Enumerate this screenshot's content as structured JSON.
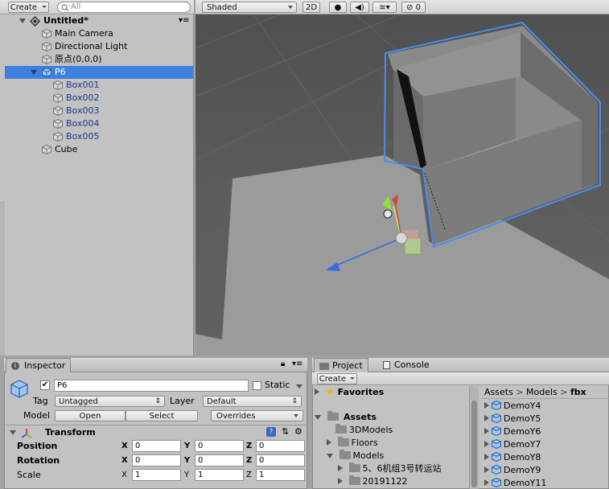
{
  "hierarchy": {
    "create_label": "Create",
    "search_placeholder": "All",
    "scene_name": "Untitled*",
    "items": [
      {
        "label": "Main Camera"
      },
      {
        "label": "Directional Light"
      },
      {
        "label": "原点(0,0,0)"
      },
      {
        "label": "P6",
        "selected": true
      },
      {
        "label": "Box001"
      },
      {
        "label": "Box002"
      },
      {
        "label": "Box003"
      },
      {
        "label": "Box004"
      },
      {
        "label": "Box005"
      },
      {
        "label": "Cube"
      }
    ]
  },
  "scene": {
    "shading_mode": "Shaded",
    "mode_2d": "2D",
    "hidden_count": "0"
  },
  "inspector": {
    "tab_label": "Inspector",
    "object_name": "P6",
    "static_label": "Static",
    "tag_label": "Tag",
    "tag_value": "Untagged",
    "layer_label": "Layer",
    "layer_value": "Default",
    "model_label": "Model",
    "open_label": "Open",
    "select_label": "Select",
    "overrides_label": "Overrides",
    "transform_title": "Transform",
    "rows": [
      {
        "label": "Position",
        "x": "0",
        "y": "0",
        "z": "0"
      },
      {
        "label": "Rotation",
        "x": "0",
        "y": "0",
        "z": "0"
      },
      {
        "label": "Scale",
        "x": "1",
        "y": "1",
        "z": "1"
      }
    ],
    "axis_x": "X",
    "axis_y": "Y",
    "axis_z": "Z"
  },
  "project": {
    "tab_label": "Project",
    "console_label": "Console",
    "create_label": "Create",
    "favorites_label": "Favorites",
    "assets_label": "Assets",
    "folders": [
      {
        "label": "3DModels"
      },
      {
        "label": "Floors"
      },
      {
        "label": "Models"
      },
      {
        "label": "5、6机组3号转运站"
      },
      {
        "label": "20191122"
      }
    ],
    "breadcrumb": [
      "Assets",
      "Models",
      "fbx"
    ],
    "files": [
      "DemoY4",
      "DemoY5",
      "DemoY6",
      "DemoY7",
      "DemoY8",
      "DemoY9",
      "DemoY11"
    ]
  },
  "colors": {
    "selection": "#3d80df",
    "panel_bg": "#c2c2c2",
    "scene_bg": "#5a5a5a",
    "blue_text": "#1d3a8f"
  }
}
